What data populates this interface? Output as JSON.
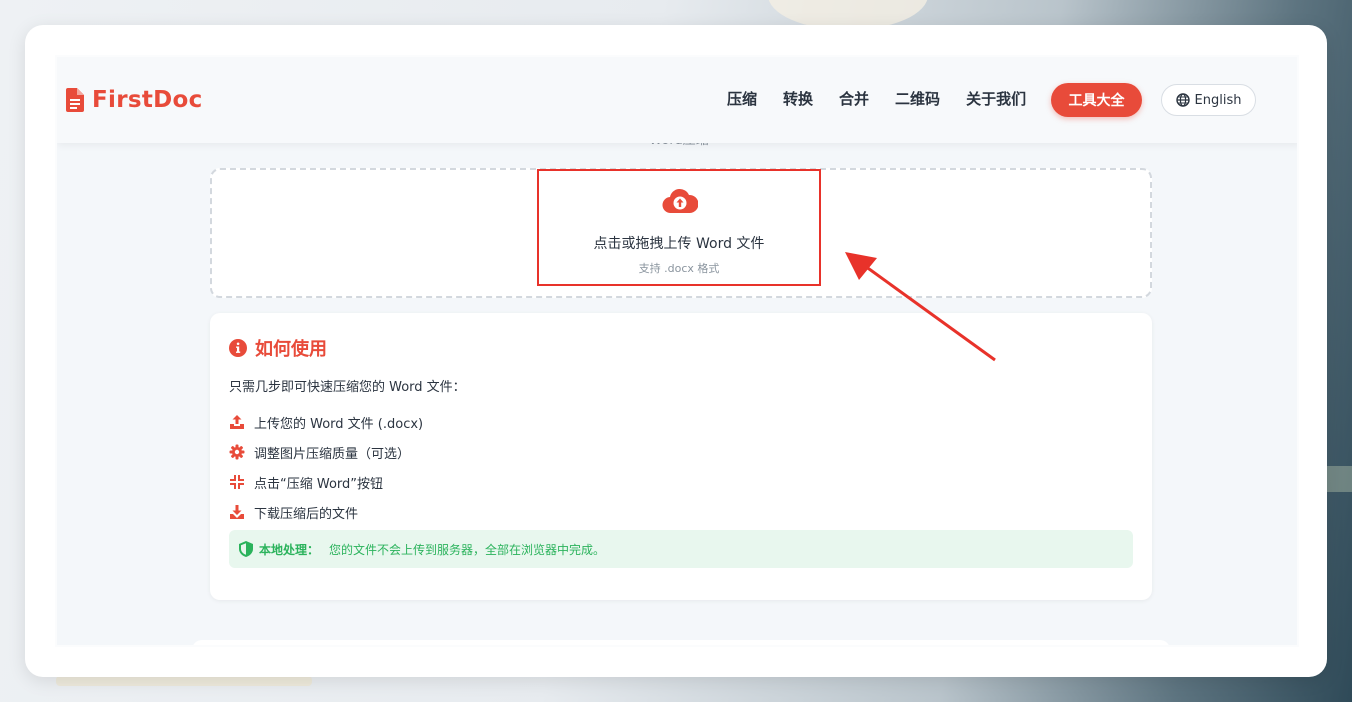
{
  "header": {
    "logo": "FirstDoc",
    "nav": [
      "压缩",
      "转换",
      "合并",
      "二维码",
      "关于我们"
    ],
    "tools_button": "工具大全",
    "language_button": "English"
  },
  "page": {
    "partial_title": "Word压缩"
  },
  "upload": {
    "main_text": "点击或拖拽上传 Word 文件",
    "sub_text": "支持 .docx 格式"
  },
  "how_to": {
    "title": "如何使用",
    "intro": "只需几步即可快速压缩您的 Word 文件：",
    "steps": [
      {
        "icon": "upload-icon",
        "text": "上传您的 Word 文件 (.docx)"
      },
      {
        "icon": "gear-icon",
        "text": "调整图片压缩质量（可选）"
      },
      {
        "icon": "compress-icon",
        "text": "点击“压缩 Word”按钮"
      },
      {
        "icon": "download-icon",
        "text": "下载压缩后的文件"
      }
    ],
    "local_label": "本地处理：",
    "local_text": "您的文件不会上传到服务器，全部在浏览器中完成。"
  },
  "colors": {
    "accent": "#e84b3a",
    "highlight": "#e8322a",
    "success": "#2bb35c"
  }
}
